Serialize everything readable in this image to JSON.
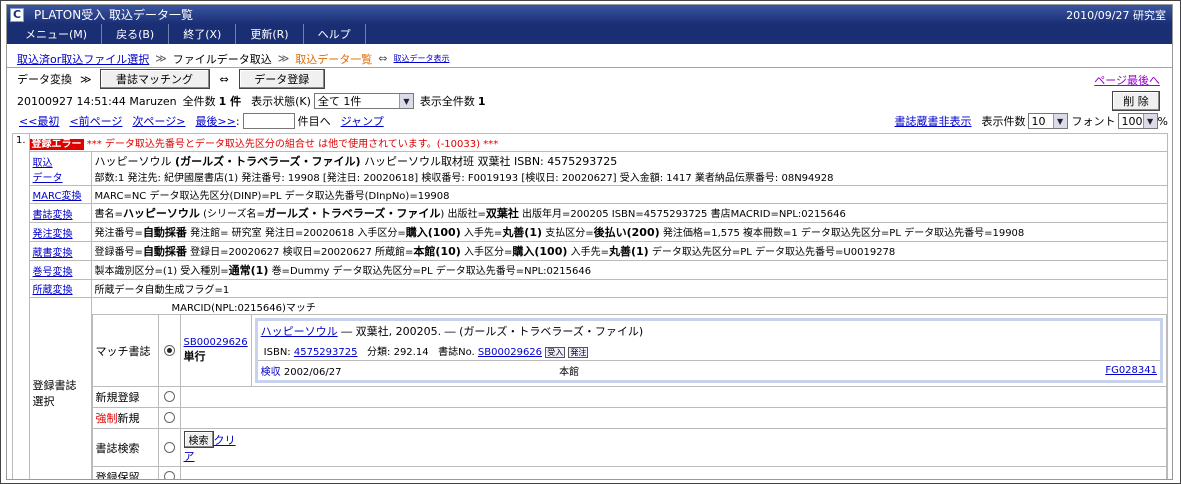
{
  "window": {
    "title": "PLATON受入 取込データ一覧",
    "status": "2010/09/27 研究室",
    "app_icon": "C"
  },
  "menu": [
    "メニュー(M)",
    "戻る(B)",
    "終了(X)",
    "更新(R)",
    "ヘルプ"
  ],
  "breadcrumb": {
    "item1": "取込済or取込ファイル選択",
    "sep": "≫",
    "item2": "ファイルデータ取込",
    "current": "取込データ一覧",
    "arrow": "⇔",
    "small": "取込データ表示"
  },
  "actions": {
    "convert_label": "データ変換",
    "sep": "≫",
    "matching_button": "書誌マッチング",
    "arrow": "⇔",
    "register_button": "データ登録",
    "page_last_link": "ページ最後へ",
    "delete_button": "削 除"
  },
  "status_row": {
    "text": "20100927 14:51:44 Maruzen",
    "total_label": "全件数",
    "total_value": "1 件",
    "display_state_label": "表示状態(K)",
    "display_state_value": "全て 1件",
    "display_total_label": "表示全件数",
    "display_total_value": "1"
  },
  "pager": {
    "first": "<<最初",
    "prev": "<前ページ",
    "next": "次ページ>",
    "last": "最後>>",
    "colon": ":",
    "goto_suffix": "件目へ",
    "jump": "ジャンプ",
    "hide_holdings": "書誌蔵書非表示",
    "per_page_label": "表示件数",
    "per_page_value": "10",
    "font_label": "フォント",
    "font_value": "100",
    "percent": "%"
  },
  "record": {
    "index": "1.",
    "error_tag": "登録エラー",
    "error_message": "*** データ取込先番号とデータ取込先区分の組合せ は他で使用されています。(-10033) ***",
    "import_label_1": "取込",
    "import_label_2": "データ",
    "import_line1_a": "ハッピーソウル",
    "import_line1_b": "(ガールズ・トラベラーズ・ファイル)",
    "import_line1_c": "ハッピーソウル取材班 双葉社 ISBN: 4575293725",
    "import_line2": "部数:1 発注先: 紀伊國屋書店(1) 発注番号: 19908 [発注日: 20020618] 検収番号: F0019193 [検収日: 20020627] 受入金額: 1417 業者納品伝票番号: 08N94928",
    "marc_label": "MARC変換",
    "marc_text": "MARC=NC データ取込先区分(DINP)=PL データ取込先番号(DInpNo)=19908",
    "biblio_label": "書誌変換",
    "biblio_text_a": "書名=",
    "biblio_title": "ハッピーソウル",
    "biblio_text_b": "(シリーズ名=",
    "biblio_series": "ガールズ・トラベラーズ・ファイル",
    "biblio_text_c": ") 出版社=",
    "biblio_publisher": "双葉社",
    "biblio_text_d": "出版年月=200205 ISBN=4575293725 書店MACRID=NPL:0215646",
    "order_label": "発注変換",
    "order_text_a": "発注番号=",
    "order_auto": "自動採番",
    "order_text_b": "発注館= 研究室 発注日=20020618 入手区分=",
    "order_buy": "購入(100)",
    "order_text_c": "入手先=",
    "order_vendor": "丸善(1)",
    "order_text_d": "支払区分=",
    "order_pay": "後払い(200)",
    "order_text_e": "発注価格=1,575 複本冊数=1 データ取込先区分=PL データ取込先番号=19908",
    "hold_label": "蔵書変換",
    "hold_text_a": "登録番号=",
    "hold_auto": "自動採番",
    "hold_text_b": "登録日=20020627 検収日=20020627 所蔵館=",
    "hold_lib": "本館(10)",
    "hold_text_c": "入手区分=",
    "hold_buy": "購入(100)",
    "hold_text_d": "入手先=",
    "hold_vendor": "丸善(1)",
    "hold_text_e": "データ取込先区分=PL データ取込先番号=U0019278",
    "vol_label": "巻号変換",
    "vol_text_a": "製本識別区分=(1) 受入種別=",
    "vol_normal": "通常(1)",
    "vol_text_b": "巻=Dummy データ取込先区分=PL データ取込先番号=NPL:0215646",
    "loc_label": "所蔵変換",
    "loc_text": "所蔵データ自動生成フラグ=1"
  },
  "selection": {
    "label_1": "登録書誌",
    "label_2": "選択",
    "marcid_match": "MARCID(NPL:0215646)マッチ",
    "match_label": "マッチ書誌",
    "sb_link": "SB00029626",
    "single": "単行",
    "m_title": "ハッピーソウル",
    "m_pub": "― 双葉社, 200205. ― (ガールズ・トラベラーズ・ファイル)",
    "m_isbn_label": "ISBN:",
    "m_isbn": "4575293725",
    "m_class": "分類: 292.14",
    "m_bib_label": "書誌No.",
    "m_bib": "SB00029626",
    "m_badge1": "受入",
    "m_badge2": "発注",
    "m_inspect": "検収",
    "m_date": "2002/06/27",
    "m_lib": "本館",
    "m_fg": "FG028341",
    "new_label": "新規登録",
    "force_red": "強制",
    "force_rest": "新規",
    "search_label": "書誌検索",
    "search_button": "検索",
    "clear_a": "クリ",
    "clear_b": "ア",
    "hold_label": "登録保留"
  }
}
